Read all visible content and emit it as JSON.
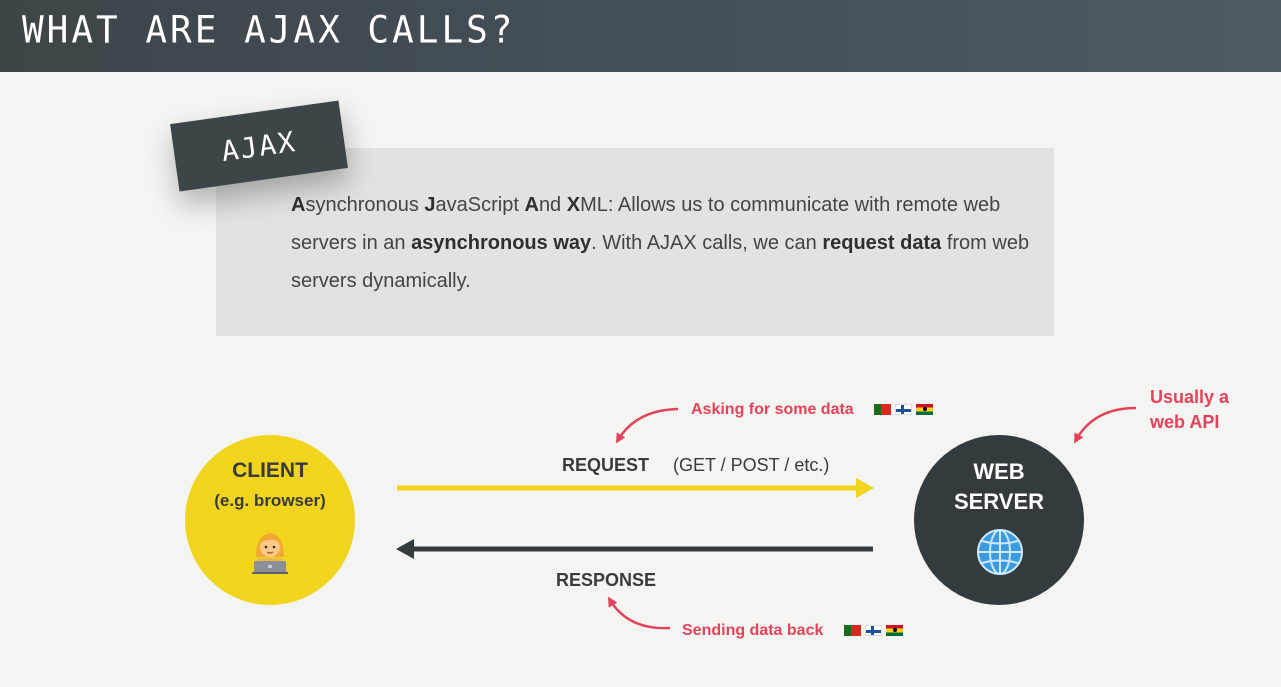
{
  "header": {
    "title": "WHAT ARE AJAX CALLS?"
  },
  "tag": {
    "label": "AJAX"
  },
  "definition": {
    "parts": [
      {
        "text": "A",
        "bold": true
      },
      {
        "text": "synchronous ",
        "bold": false
      },
      {
        "text": "J",
        "bold": true
      },
      {
        "text": "avaScript ",
        "bold": false
      },
      {
        "text": "A",
        "bold": true
      },
      {
        "text": "nd ",
        "bold": false
      },
      {
        "text": "X",
        "bold": true
      },
      {
        "text": "ML: Allows us to communicate with remote web servers in an ",
        "bold": false
      },
      {
        "text": "asynchronous way",
        "bold": true
      },
      {
        "text": ". With AJAX calls, we can ",
        "bold": false
      },
      {
        "text": "request data",
        "bold": true
      },
      {
        "text": " from web servers dynamically.",
        "bold": false
      }
    ]
  },
  "client": {
    "title": "CLIENT",
    "subtitle": "(e.g. browser)",
    "icon": "person-with-laptop-icon"
  },
  "server": {
    "title_line1": "WEB",
    "title_line2": "SERVER",
    "icon": "globe-icon"
  },
  "request": {
    "label": "REQUEST",
    "methods": "(GET / POST / etc.)"
  },
  "response": {
    "label": "RESPONSE"
  },
  "notes": {
    "asking": "Asking for some data",
    "sending": "Sending data back",
    "usually_line1": "Usually a",
    "usually_line2": "web API"
  },
  "colors": {
    "yellow": "#f0d41d",
    "dark": "#343b3e",
    "accent": "#e2435a",
    "header": "#3d4548"
  }
}
